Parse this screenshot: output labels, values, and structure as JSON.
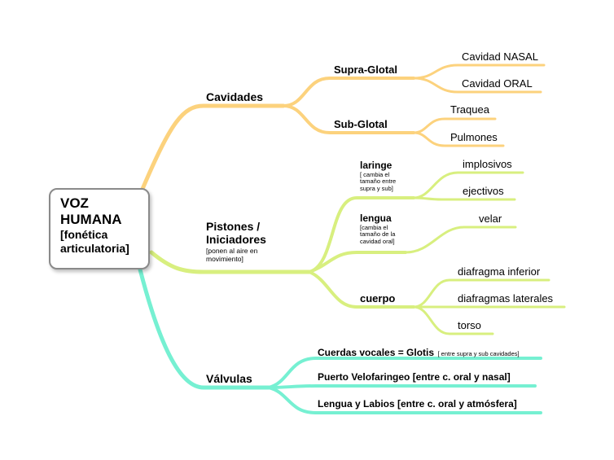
{
  "colors": {
    "cavidades": "#fcd27d",
    "pistones": "#d8ef7f",
    "valvulas": "#76f0d2"
  },
  "root": {
    "title_1": "VOZ",
    "title_2": "HUMANA",
    "sub_1": "[fonética",
    "sub_2": "articulatoria]"
  },
  "cavidades": {
    "label": "Cavidades",
    "supra": {
      "label": "Supra-Glotal",
      "items": [
        "Cavidad NASAL",
        "Cavidad ORAL"
      ]
    },
    "sub": {
      "label": "Sub-Glotal",
      "items": [
        "Traquea",
        "Pulmones"
      ]
    }
  },
  "pistones": {
    "label_1": "Pistones /",
    "label_2": "Iniciadores",
    "note_1": "[ponen al aire en",
    "note_2": "movimiento]",
    "laringe": {
      "label": "laringe",
      "note_1": "[ cambia el",
      "note_2": "tamaño entre",
      "note_3": "supra y sub]",
      "items": [
        "implosivos",
        "ejectivos"
      ]
    },
    "lengua": {
      "label": "lengua",
      "note_1": "[cambia el",
      "note_2": "tamaño de la",
      "note_3": "cavidad oral]",
      "items": [
        "velar"
      ]
    },
    "cuerpo": {
      "label": "cuerpo",
      "items": [
        "diafragma inferior",
        "diafragmas laterales",
        "torso"
      ]
    }
  },
  "valvulas": {
    "label": "Válvulas",
    "items": [
      {
        "label": "Cuerdas vocales = Glotis",
        "note": "[ entre supra y sub cavidades]"
      },
      {
        "label": "Puerto Velofaringeo  [entre c. oral y nasal]"
      },
      {
        "label": "Lengua y Labios [entre c. oral y atmósfera]"
      }
    ]
  }
}
